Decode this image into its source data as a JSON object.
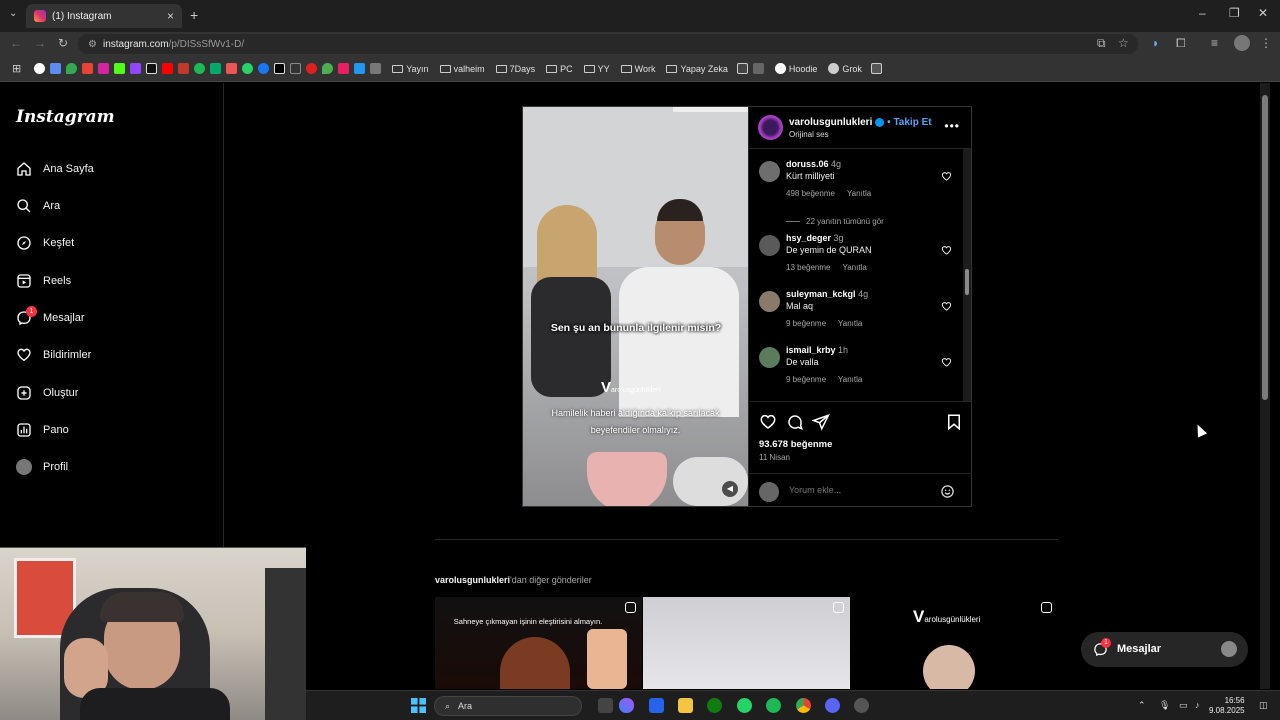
{
  "browser": {
    "tab_title": "(1) Instagram",
    "url_host": "instagram.com",
    "url_path": "/p/DISsSfWv1-D/",
    "bookmarks": [
      "Yayın",
      "valheim",
      "7Days",
      "PC",
      "YY",
      "Work",
      "Yapay Zeka",
      "Hoodie",
      "Grok"
    ]
  },
  "sidebar": {
    "logo": "Instagram",
    "items": [
      {
        "label": "Ana Sayfa",
        "icon": "home-icon"
      },
      {
        "label": "Ara",
        "icon": "search-icon"
      },
      {
        "label": "Keşfet",
        "icon": "compass-icon"
      },
      {
        "label": "Reels",
        "icon": "reels-icon"
      },
      {
        "label": "Mesajlar",
        "icon": "messenger-icon",
        "badge": "1"
      },
      {
        "label": "Bildirimler",
        "icon": "heart-icon"
      },
      {
        "label": "Oluştur",
        "icon": "plus-square-icon"
      },
      {
        "label": "Pano",
        "icon": "dashboard-icon"
      },
      {
        "label": "Profil",
        "icon": "avatar"
      }
    ]
  },
  "post": {
    "username": "varolusgunlukleri",
    "follow": "Takip Et",
    "separator": "•",
    "audio": "Orijinal ses",
    "video_caption_top": "Sen şu an bununla ilgilenir misin?",
    "video_logo_letter": "V",
    "video_logo_text": "arolusgünlükleri",
    "video_caption_bottom": "Hamilelik haberi aldığında kalkıp sarılacak beyefendiler olmalıyız.",
    "likes": "93.678 beğenme",
    "date": "11 Nisan",
    "comment_placeholder": "Yorum ekle...",
    "comments": [
      {
        "user": "doruss.06",
        "ago": "4g",
        "text": "Kürt milliyeti",
        "likes": "498 beğenme",
        "reply": "Yanıtla"
      },
      {
        "user": "hsy_deger",
        "ago": "3g",
        "text": "De yemin de QURAN",
        "likes": "13 beğenme",
        "reply": "Yanıtla"
      },
      {
        "user": "suleyman_kckgl",
        "ago": "4g",
        "text": "Mal aq",
        "likes": "9 beğenme",
        "reply": "Yanıtla"
      },
      {
        "user": "ismail_krby",
        "ago": "1h",
        "text": "De valla",
        "likes": "9 beğenme",
        "reply": "Yanıtla"
      }
    ],
    "view_replies": "22 yanıtın tümünü gör"
  },
  "more": {
    "user": "varolusgunlukleri",
    "suffix": "'dan diğer gönderiler",
    "thumb1_caption": "Sahneye çıkmayan işinin eleştirisini almayın.",
    "thumb3_logo_letter": "V",
    "thumb3_logo_text": "arolusgünlükleri"
  },
  "messages_button": {
    "label": "Mesajlar",
    "badge": "1"
  },
  "taskbar": {
    "search_label": "Ara",
    "time": "16:56",
    "date": "9.08.2025"
  },
  "colors": {
    "accent": "#0095f6",
    "badge": "#ff3040",
    "follow": "#5ba4f6"
  }
}
